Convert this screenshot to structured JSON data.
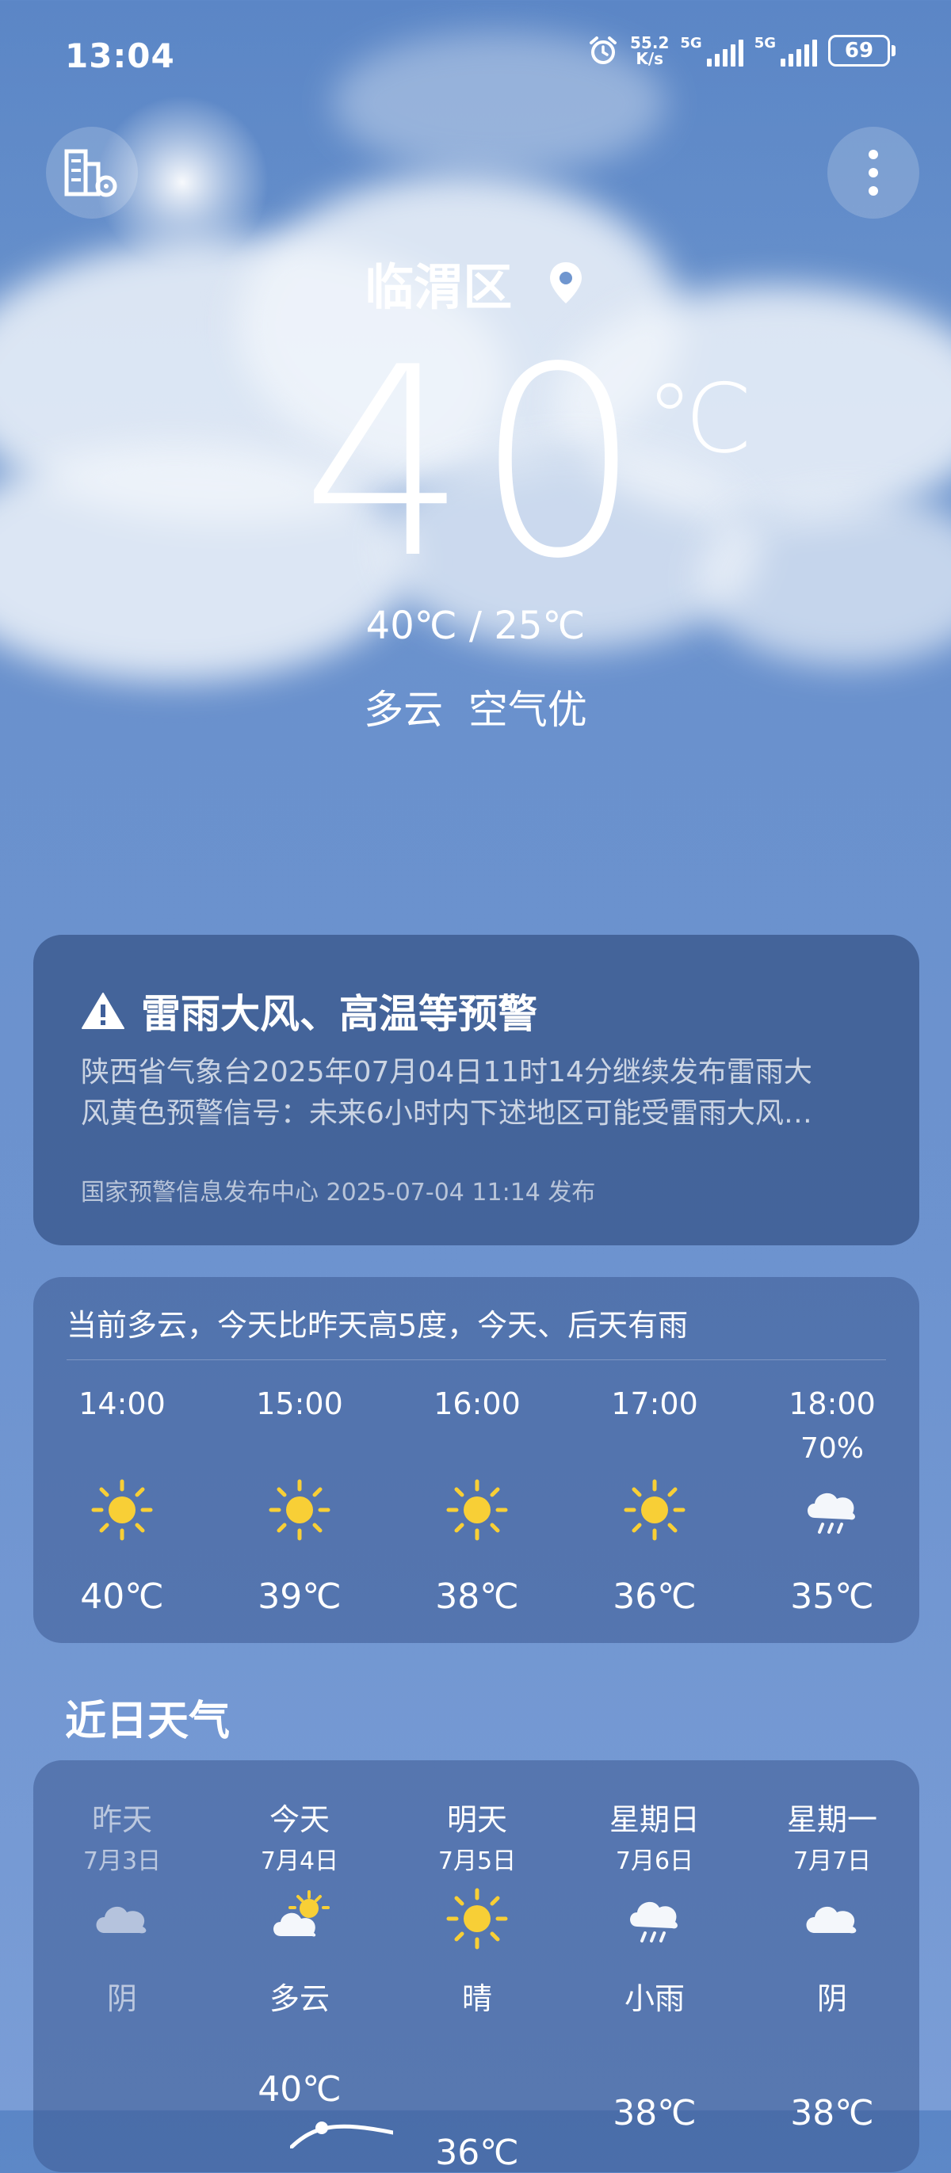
{
  "status_bar": {
    "time": "13:04",
    "net_speed_value": "55.2",
    "net_speed_unit": "K/s",
    "signal_1": "5G",
    "signal_2": "5G",
    "battery": "69"
  },
  "header": {
    "location": "临渭区",
    "current_temp": "40",
    "temp_unit": "℃",
    "temp_range": "40℃ / 25℃",
    "condition": "多云  空气优"
  },
  "alert": {
    "title": "雷雨大风、高温等预警",
    "line1": "陕西省气象台2025年07月04日11时14分继续发布雷雨大",
    "line2": "风黄色预警信号：未来6小时内下述地区可能受雷雨大风…",
    "source": "国家预警信息发布中心 2025-07-04 11:14 发布"
  },
  "hourly": {
    "summary": "当前多云，今天比昨天高5度，今天、后天有雨",
    "items": [
      {
        "time": "14:00",
        "prob": "",
        "icon": "sun-icon",
        "temp": "40℃"
      },
      {
        "time": "15:00",
        "prob": "",
        "icon": "sun-icon",
        "temp": "39℃"
      },
      {
        "time": "16:00",
        "prob": "",
        "icon": "sun-icon",
        "temp": "38℃"
      },
      {
        "time": "17:00",
        "prob": "",
        "icon": "sun-icon",
        "temp": "36℃"
      },
      {
        "time": "18:00",
        "prob": "70%",
        "icon": "rain-cloud-icon",
        "temp": "35℃"
      }
    ]
  },
  "recent": {
    "title": "近日天气",
    "days": [
      {
        "day": "昨天",
        "date": "7月3日",
        "icon": "cloud-icon",
        "cond": "阴",
        "high": ""
      },
      {
        "day": "今天",
        "date": "7月4日",
        "icon": "partly-cloudy-icon",
        "cond": "多云",
        "high": "40℃"
      },
      {
        "day": "明天",
        "date": "7月5日",
        "icon": "sun-icon",
        "cond": "晴",
        "high": "36℃"
      },
      {
        "day": "星期日",
        "date": "7月6日",
        "icon": "rain-cloud-icon",
        "cond": "小雨",
        "high": "38℃"
      },
      {
        "day": "星期一",
        "date": "7月7日",
        "icon": "cloud-icon",
        "cond": "阴",
        "high": "38℃"
      }
    ]
  },
  "colors": {
    "sun": "#f8cf36",
    "card_bg": "#4a6aa6",
    "accent_white": "#ffffff"
  }
}
